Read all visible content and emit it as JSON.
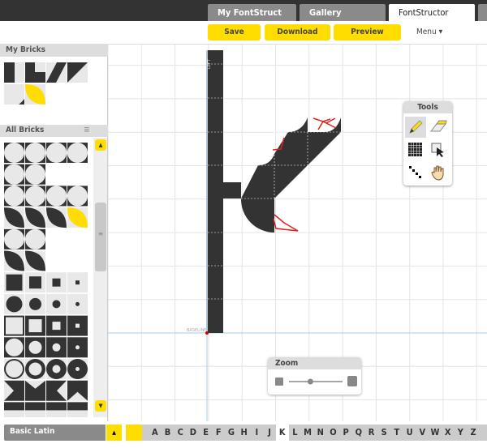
{
  "tabs": [
    {
      "label": "My FontStruct",
      "active": false
    },
    {
      "label": "Gallery",
      "active": false
    },
    {
      "label": "FontStructor",
      "active": true
    }
  ],
  "toolbar": {
    "save": "Save",
    "download": "Download",
    "preview": "Preview",
    "menu": "Menu",
    "menu_icon": "caret-down-icon"
  },
  "my_bricks": {
    "title": "My Bricks",
    "bricks": [
      "half-left",
      "l-shape",
      "parallelogram",
      "triangle",
      "corner-small",
      "leaf-yellow"
    ]
  },
  "all_bricks": {
    "title": "All Bricks",
    "menu_icon": "hamburger-icon",
    "rows": [
      [
        "circ",
        "circ",
        "circ",
        "circ"
      ],
      [
        "circ",
        "circ"
      ],
      [
        "circ",
        "circ",
        "circ",
        "circ"
      ],
      [
        "leaf",
        "leaf",
        "leaf",
        "leaf-yellow"
      ],
      [
        "circ",
        "circ"
      ],
      [
        "petal",
        "petal"
      ],
      [
        "sq1",
        "sq2",
        "sq3",
        "sq4"
      ],
      [
        "dot1",
        "dot2",
        "dot3",
        "dot4"
      ],
      [
        "frame1",
        "frame2",
        "frame3",
        "frame4"
      ],
      [
        "hole1",
        "hole2",
        "hole3",
        "hole4"
      ],
      [
        "ring1",
        "ring2",
        "ring3",
        "ring4"
      ],
      [
        "bow1",
        "bow2",
        "bow3",
        "bow4"
      ],
      [
        "bar",
        "bar",
        "bar",
        "bar"
      ]
    ]
  },
  "canvas": {
    "left_label": "LEFT",
    "baseline_label": "BASELINE"
  },
  "tools": {
    "title": "Tools",
    "items": [
      "pencil-icon",
      "eraser-icon",
      "grid-fill-icon",
      "select-arrow-icon",
      "diagonal-dots-icon",
      "hand-icon"
    ]
  },
  "zoom": {
    "title": "Zoom",
    "level": 0.4,
    "min_icon": "zoom-out-icon",
    "max_icon": "zoom-in-icon"
  },
  "glyph_bar": {
    "set": "Basic Latin",
    "letters": [
      "A",
      "B",
      "C",
      "D",
      "E",
      "F",
      "G",
      "H",
      "I",
      "J",
      "K",
      "L",
      "M",
      "N",
      "O",
      "P",
      "Q",
      "R",
      "S",
      "T",
      "U",
      "V",
      "W",
      "X",
      "Y",
      "Z"
    ],
    "selected": "K"
  },
  "colors": {
    "accent": "#ffdd00",
    "brick": "#333333",
    "grid": "#e4e4e4",
    "guide": "#a9cbe6"
  }
}
